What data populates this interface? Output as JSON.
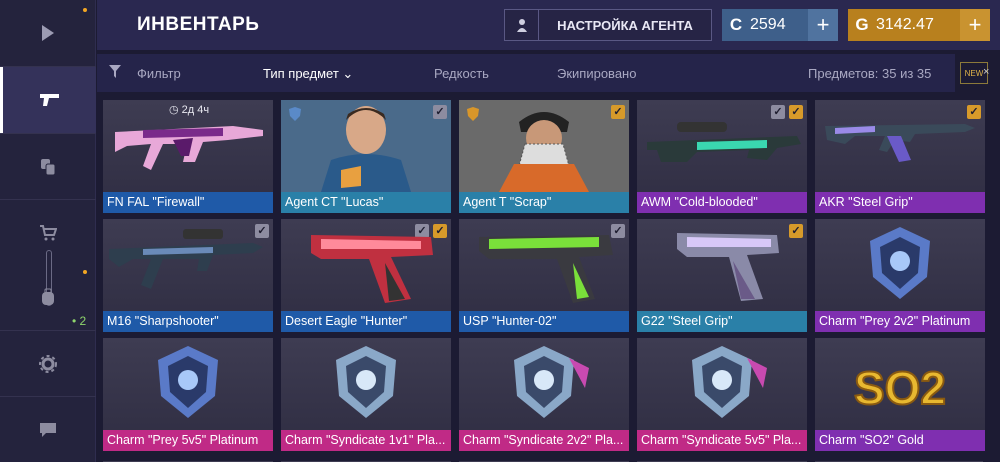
{
  "sidebar": {
    "items": [
      {
        "icon": "play-icon"
      },
      {
        "icon": "pistol-icon"
      },
      {
        "icon": "coins-icon"
      },
      {
        "icon": "cart-icon"
      },
      {
        "icon": "backpack-icon",
        "badge": "2"
      },
      {
        "icon": "gear-icon"
      },
      {
        "icon": "chat-icon"
      }
    ]
  },
  "header": {
    "title": "ИНВЕНТАРЬ",
    "agent_button": "НАСТРОЙКА АГЕНТА",
    "silver_balance": "2594",
    "gold_balance": "3142.47",
    "silver_symbol": "C",
    "gold_symbol": "G",
    "plus": "+"
  },
  "filters": {
    "filter": "Фильтр",
    "type": "Тип предмет",
    "rarity": "Редкость",
    "equipped": "Экипировано",
    "count": "Предметов: 35 из 35",
    "new_label": "NEW",
    "close": "×"
  },
  "colors": {
    "blue": "#1f5aa8",
    "cyan": "#2a80a8",
    "purple": "#7f2fb0",
    "pink": "#c02a86",
    "gold": "#d79a2a"
  },
  "items": [
    {
      "name": "FN FAL \"Firewall\"",
      "rarity": "blue",
      "timer": "2д 4ч"
    },
    {
      "name": "Agent CT \"Lucas\"",
      "rarity": "cyan",
      "check": "grey"
    },
    {
      "name": "Agent T \"Scrap\"",
      "rarity": "cyan",
      "check": "gold"
    },
    {
      "name": "AWM \"Cold-blooded\"",
      "rarity": "purple",
      "check": "both"
    },
    {
      "name": "AKR \"Steel Grip\"",
      "rarity": "purple",
      "check": "gold"
    },
    {
      "name": "M16 \"Sharpshooter\"",
      "rarity": "blue",
      "check": "grey"
    },
    {
      "name": "Desert Eagle \"Hunter\"",
      "rarity": "blue",
      "check": "both"
    },
    {
      "name": "USP \"Hunter-02\"",
      "rarity": "blue",
      "check": "grey"
    },
    {
      "name": "G22 \"Steel Grip\"",
      "rarity": "cyan",
      "check": "gold"
    },
    {
      "name": "Charm \"Prey 2v2\" Platinum",
      "rarity": "purple"
    },
    {
      "name": "Charm \"Prey 5v5\" Platinum",
      "rarity": "pink"
    },
    {
      "name": "Charm \"Syndicate 1v1\" Pla...",
      "rarity": "pink"
    },
    {
      "name": "Charm \"Syndicate 2v2\" Pla...",
      "rarity": "pink"
    },
    {
      "name": "Charm \"Syndicate 5v5\" Pla...",
      "rarity": "pink"
    },
    {
      "name": "Charm \"SO2\" Gold",
      "rarity": "purple",
      "logo_text": "SO2"
    }
  ]
}
